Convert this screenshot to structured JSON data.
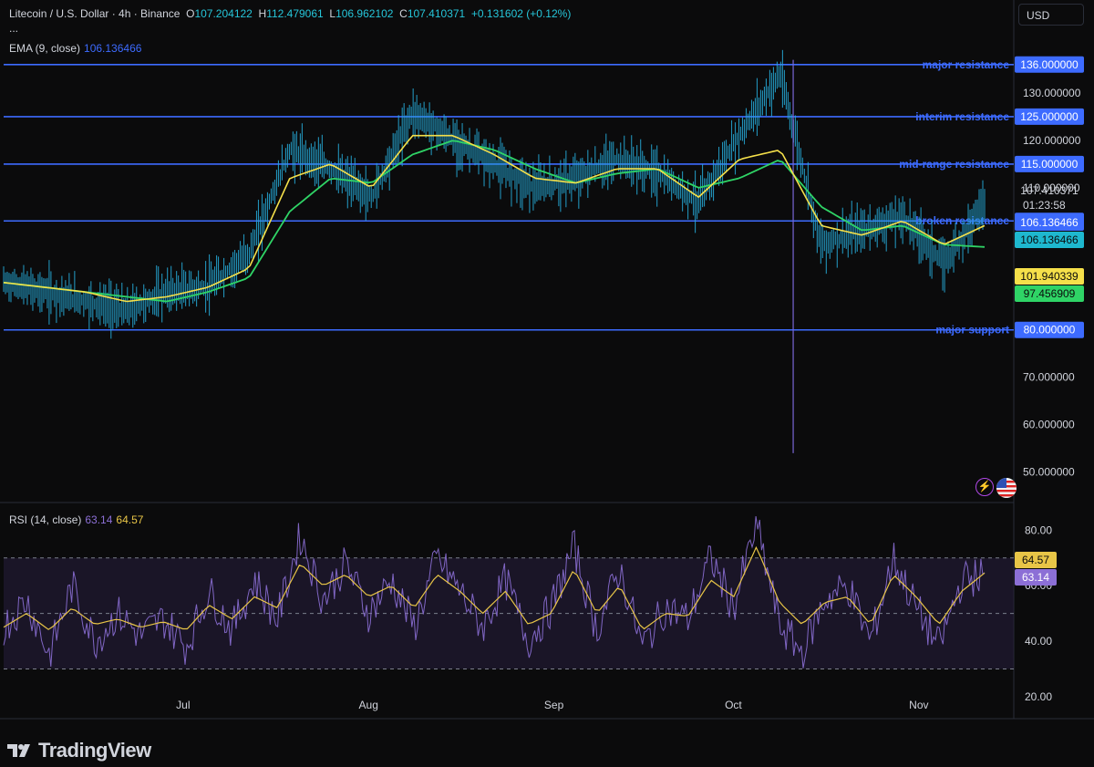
{
  "header": {
    "symbol": "Litecoin / U.S. Dollar · 4h · Binance",
    "open_label": "O",
    "open": "107.204122",
    "high_label": "H",
    "high": "112.479061",
    "low_label": "L",
    "low": "106.962102",
    "close_label": "C",
    "close": "107.410371",
    "change": "+0.131602 (+0.12%)",
    "more": "...",
    "currency": "USD"
  },
  "ema_legend": {
    "label": "EMA (9, close)",
    "value": "106.136466"
  },
  "rsi_legend": {
    "label": "RSI (14, close)",
    "rsi": "63.14",
    "ma": "64.57"
  },
  "brand": "TradingView",
  "colors": {
    "bg": "#0b0b0c",
    "candle": "#26a9d6",
    "ema_fast": "#f5e04a",
    "ema_slow": "#2fd466",
    "level": "#3d6bff",
    "rsi": "#8c6fd6",
    "rsi_ma": "#e8c547",
    "rsi_band": "#241d3a"
  },
  "chart_data": [
    {
      "type": "line",
      "name": "price",
      "x": [
        "2024-06-01",
        "2024-06-08",
        "2024-06-15",
        "2024-06-22",
        "2024-06-29",
        "2024-07-06",
        "2024-07-13",
        "2024-07-20",
        "2024-07-27",
        "2024-08-03",
        "2024-08-10",
        "2024-08-17",
        "2024-08-24",
        "2024-08-31",
        "2024-09-07",
        "2024-09-14",
        "2024-09-21",
        "2024-09-28",
        "2024-10-05",
        "2024-10-12",
        "2024-10-19",
        "2024-10-26",
        "2024-11-02",
        "2024-11-09",
        "2024-11-12"
      ],
      "x_tick_labels": [
        "Jul",
        "Aug",
        "Sep",
        "Oct",
        "Nov"
      ],
      "x_ticks": [
        "2024-07-01",
        "2024-08-01",
        "2024-09-01",
        "2024-10-01",
        "2024-11-01"
      ],
      "series": [
        {
          "values": [
            90,
            88,
            86,
            84,
            88,
            89,
            96,
            118,
            114,
            108,
            126,
            120,
            115,
            110,
            112,
            116,
            113,
            107,
            121,
            134,
            98,
            101,
            104,
            94,
            107
          ]
        },
        {
          "values": [
            90,
            89,
            88,
            86,
            87,
            89,
            93,
            112,
            115,
            110,
            121,
            121,
            117,
            112,
            111,
            114,
            114,
            108,
            116,
            118,
            102,
            100,
            103,
            98,
            102
          ]
        },
        {
          "values": [
            90,
            89,
            88,
            87,
            86,
            88,
            91,
            105,
            112,
            111,
            117,
            120,
            118,
            114,
            111,
            113,
            114,
            110,
            112,
            116,
            106,
            101,
            102,
            98,
            97.5
          ]
        }
      ],
      "levels": [
        {
          "label": "major resistance",
          "value": 136,
          "tag": "136.000000"
        },
        {
          "label": "interim resistance",
          "value": 125,
          "tag": "125.000000"
        },
        {
          "label": "mid-range resistance",
          "value": 115,
          "tag": "115.000000"
        },
        {
          "label": "broken resistance",
          "value": 103,
          "tag": "103.000000"
        },
        {
          "label": "major support",
          "value": 80,
          "tag": "80.000000"
        }
      ],
      "price_tags": [
        {
          "value": 107.410371,
          "text": "107.410371",
          "sub": "01:23:58",
          "kind": "last"
        },
        {
          "value": 106.136466,
          "text": "106.136466",
          "kind": "ema"
        },
        {
          "value": 106.136466,
          "text": "106.136466",
          "kind": "cyan"
        },
        {
          "value": 101.940339,
          "text": "101.940339",
          "kind": "fast"
        },
        {
          "value": 97.456909,
          "text": "97.456909",
          "kind": "slow"
        }
      ],
      "y_ticks": [
        {
          "v": 130,
          "t": "130.000000"
        },
        {
          "v": 120,
          "t": "120.000000"
        },
        {
          "v": 110,
          "t": "110.000000"
        },
        {
          "v": 70,
          "t": "70.000000"
        },
        {
          "v": 60,
          "t": "60.000000"
        },
        {
          "v": 50,
          "t": "50.000000"
        }
      ],
      "ylim": [
        48,
        140
      ]
    },
    {
      "type": "line",
      "name": "rsi",
      "series": [
        {
          "values": [
            45,
            55,
            35,
            60,
            40,
            50,
            42,
            48,
            38,
            58,
            44,
            62,
            48,
            78,
            55,
            68,
            50,
            62,
            45,
            70,
            58,
            45,
            62,
            40,
            52,
            74,
            44,
            66,
            38,
            52,
            48,
            70,
            52,
            82,
            46,
            36,
            55,
            60,
            40,
            70,
            52,
            38,
            62,
            64
          ]
        },
        {
          "values": [
            45,
            50,
            44,
            52,
            46,
            48,
            45,
            47,
            44,
            53,
            48,
            56,
            52,
            68,
            60,
            64,
            56,
            60,
            52,
            64,
            58,
            50,
            58,
            46,
            50,
            66,
            50,
            60,
            44,
            50,
            49,
            62,
            56,
            74,
            54,
            46,
            54,
            56,
            46,
            64,
            56,
            46,
            58,
            64.57
          ]
        }
      ],
      "ylim": [
        18,
        87
      ],
      "bands": [
        70,
        50,
        30
      ],
      "y_ticks": [
        {
          "v": 80,
          "t": "80.00"
        },
        {
          "v": 60,
          "t": "60.00"
        },
        {
          "v": 40,
          "t": "40.00"
        },
        {
          "v": 20,
          "t": "20.00"
        }
      ],
      "tags": [
        {
          "value": 64.57,
          "text": "64.57",
          "kind": "ma"
        },
        {
          "value": 63.14,
          "text": "63.14",
          "kind": "rsi"
        }
      ]
    }
  ]
}
